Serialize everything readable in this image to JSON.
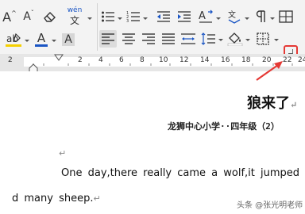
{
  "ruler": {
    "numbers": [
      "2",
      "2",
      "4",
      "6",
      "8",
      "10",
      "12",
      "14",
      "16",
      "18",
      "20",
      "22",
      "24"
    ]
  },
  "toolbar": {
    "font_color": "#1a55c4",
    "highlight_color": "#f5d000",
    "pinyin_label": "wén"
  },
  "document": {
    "title": "狼来了",
    "subtitle": "龙狮中心小学··四年级（2）",
    "line1": "One day,there really came a wolf,it jumped",
    "line2": "d many sheep.",
    "paragraph_mark": "↵"
  },
  "watermark": "头条 @张光明老师",
  "accent_color": "#e53935"
}
